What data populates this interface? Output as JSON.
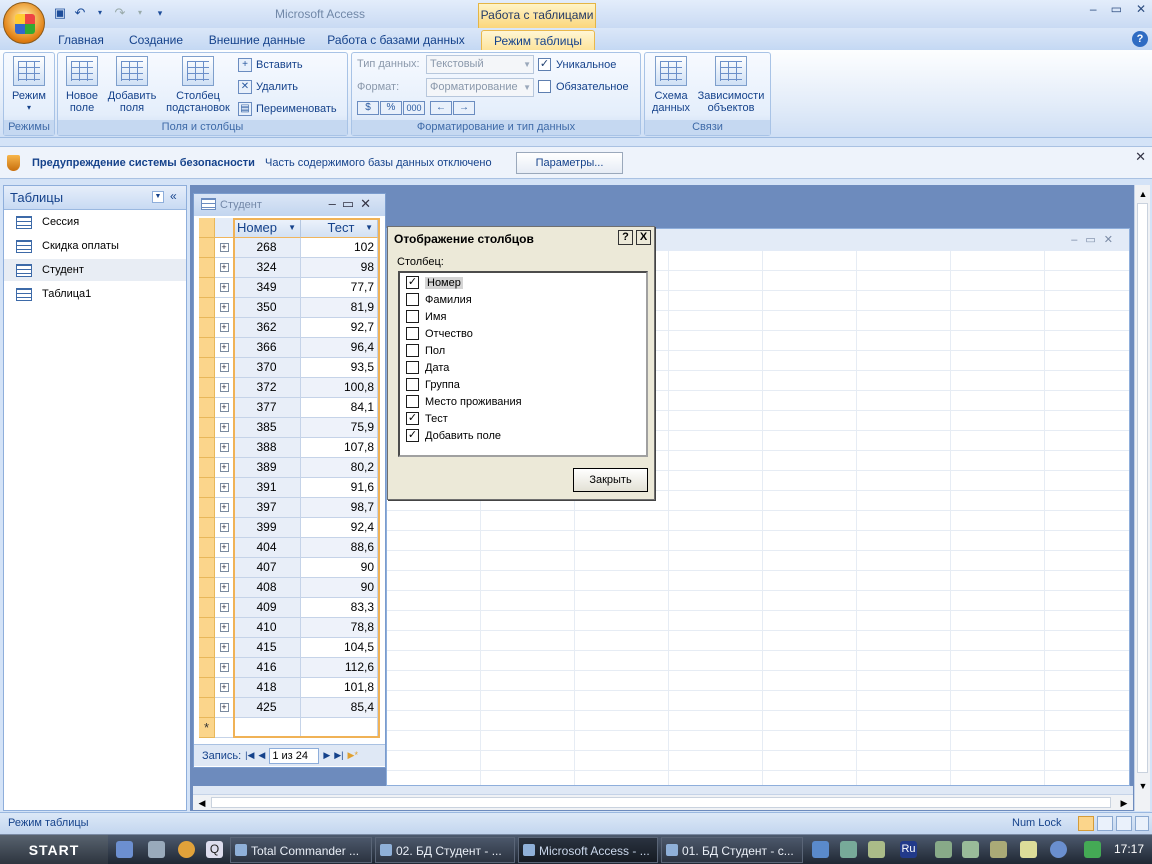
{
  "titlebar": {
    "app_title": "Microsoft Access",
    "context_tab_title": "Работа с таблицами"
  },
  "tabs": [
    "Главная",
    "Создание",
    "Внешние данные",
    "Работа с базами данных",
    "Режим таблицы"
  ],
  "ribbon": {
    "mode_group": {
      "label": "Режимы",
      "view_btn": "Режим"
    },
    "fields_group": {
      "label": "Поля и столбцы",
      "new_field": [
        "Новое",
        "поле"
      ],
      "add_fields": [
        "Добавить",
        "поля"
      ],
      "lookup_column": [
        "Столбец",
        "подстановок"
      ],
      "insert": "Вставить",
      "delete": "Удалить",
      "rename": "Переименовать"
    },
    "format_group": {
      "label": "Форматирование и тип данных",
      "data_type_label": "Тип данных:",
      "data_type_value": "Текстовый",
      "format_label": "Формат:",
      "format_value": "Форматирование",
      "unique": "Уникальное",
      "unique_checked": true,
      "required": "Обязательное",
      "required_checked": false,
      "percent": "%",
      "thousands": "000"
    },
    "relations_group": {
      "label": "Связи",
      "schema": [
        "Схема",
        "данных"
      ],
      "deps": [
        "Зависимости",
        "объектов"
      ]
    }
  },
  "security": {
    "title": "Предупреждение системы безопасности",
    "message": "Часть содержимого базы данных отключено",
    "button": "Параметры..."
  },
  "nav_pane": {
    "title": "Таблицы",
    "items": [
      "Сессия",
      "Скидка оплаты",
      "Студент",
      "Таблица1"
    ],
    "selected": "Студент"
  },
  "student_window": {
    "title": "Студент",
    "columns": [
      "Номер",
      "Тест"
    ],
    "rows": [
      [
        "268",
        "102"
      ],
      [
        "324",
        "98"
      ],
      [
        "349",
        "77,7"
      ],
      [
        "350",
        "81,9"
      ],
      [
        "362",
        "92,7"
      ],
      [
        "366",
        "96,4"
      ],
      [
        "370",
        "93,5"
      ],
      [
        "372",
        "100,8"
      ],
      [
        "377",
        "84,1"
      ],
      [
        "385",
        "75,9"
      ],
      [
        "388",
        "107,8"
      ],
      [
        "389",
        "80,2"
      ],
      [
        "391",
        "91,6"
      ],
      [
        "397",
        "98,7"
      ],
      [
        "399",
        "92,4"
      ],
      [
        "404",
        "88,6"
      ],
      [
        "407",
        "90"
      ],
      [
        "408",
        "90"
      ],
      [
        "409",
        "83,3"
      ],
      [
        "410",
        "78,8"
      ],
      [
        "415",
        "104,5"
      ],
      [
        "416",
        "112,6"
      ],
      [
        "418",
        "101,8"
      ],
      [
        "425",
        "85,4"
      ]
    ],
    "new_row_marker": "*",
    "record_label": "Запись:",
    "record_pos": "1 из 24"
  },
  "dialog": {
    "title": "Отображение столбцов",
    "help": "?",
    "close_x": "X",
    "column_label": "Столбец:",
    "options": [
      {
        "label": "Номер",
        "checked": true
      },
      {
        "label": "Фамилия",
        "checked": false
      },
      {
        "label": "Имя",
        "checked": false
      },
      {
        "label": "Отчество",
        "checked": false
      },
      {
        "label": "Пол",
        "checked": false
      },
      {
        "label": "Дата",
        "checked": false
      },
      {
        "label": "Группа",
        "checked": false
      },
      {
        "label": "Место проживания",
        "checked": false
      },
      {
        "label": "Тест",
        "checked": true
      },
      {
        "label": "Добавить поле",
        "checked": true
      }
    ],
    "close_button": "Закрыть"
  },
  "status": {
    "text": "Режим таблицы",
    "numlock": "Num Lock"
  },
  "taskbar": {
    "start": "START",
    "tasks": [
      "Total Commander ...",
      "02. БД Студент - ...",
      "Microsoft Access - ...",
      "01. БД Студент - с..."
    ],
    "active_task": 2,
    "lang": "Ru",
    "clock": "17:17"
  }
}
